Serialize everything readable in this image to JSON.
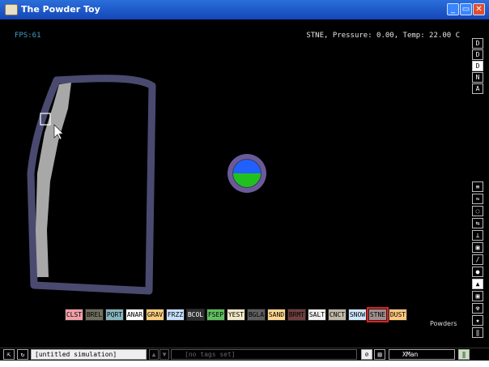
{
  "window": {
    "title": "The Powder Toy",
    "min_label": "_",
    "max_label": "▭",
    "close_label": "✕"
  },
  "hud": {
    "fps": "FPS:61",
    "status": "STNE, Pressure: 0.00, Temp: 22.00 C"
  },
  "right_toolbar_top": [
    "D",
    "D",
    "D",
    "N",
    "A"
  ],
  "right_toolbar_tools": [
    "≡",
    "≈",
    "◌",
    "⇆",
    "⟂",
    "▣",
    "/",
    "●",
    "▲",
    "▣",
    "☢",
    "★",
    "‖"
  ],
  "category_label": "Powders",
  "elements": [
    {
      "label": "CLST",
      "bg": "#f0a0a8",
      "fg": "#000"
    },
    {
      "label": "BREL",
      "bg": "#707060",
      "fg": "#000"
    },
    {
      "label": "PQRT",
      "bg": "#88b8c0",
      "fg": "#000"
    },
    {
      "label": "ANAR",
      "bg": "#ffffff",
      "fg": "#000"
    },
    {
      "label": "GRAV",
      "bg": "#ffd080",
      "fg": "#000"
    },
    {
      "label": "FRZZ",
      "bg": "#c8e0ff",
      "fg": "#000"
    },
    {
      "label": "BCOL",
      "bg": "#303030",
      "fg": "#fff"
    },
    {
      "label": "FSEP",
      "bg": "#60c060",
      "fg": "#000"
    },
    {
      "label": "YEST",
      "bg": "#f0e8c8",
      "fg": "#000"
    },
    {
      "label": "BGLA",
      "bg": "#606060",
      "fg": "#000"
    },
    {
      "label": "SAND",
      "bg": "#ffd890",
      "fg": "#000"
    },
    {
      "label": "BRMT",
      "bg": "#704040",
      "fg": "#000"
    },
    {
      "label": "SALT",
      "bg": "#f0f0f0",
      "fg": "#000"
    },
    {
      "label": "CNCT",
      "bg": "#c0b8a8",
      "fg": "#000"
    },
    {
      "label": "SNOW",
      "bg": "#d0e8ff",
      "fg": "#000"
    },
    {
      "label": "STNE",
      "bg": "#a09090",
      "fg": "#000",
      "selected": true
    },
    {
      "label": "DUST",
      "bg": "#ffc880",
      "fg": "#000"
    }
  ],
  "bottom": {
    "sim_name": "[untitled simulation]",
    "tags": "[no tags set]",
    "user": "XMan",
    "pause": "‖"
  },
  "colors": {
    "wall": "#4a4a70",
    "powder": "#a8a8a8",
    "ball_top": "#2060ff",
    "ball_bottom": "#20c020",
    "ring": "#6a5a9a"
  }
}
